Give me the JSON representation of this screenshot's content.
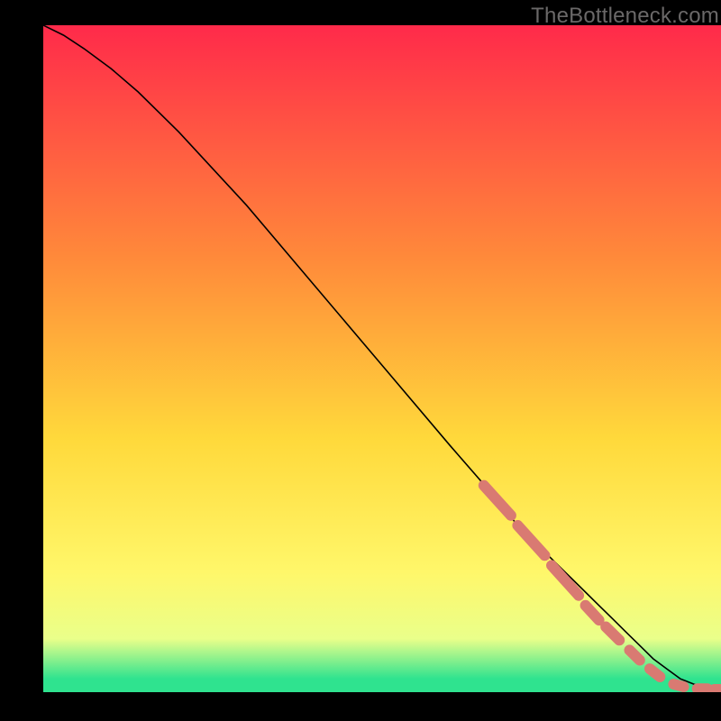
{
  "watermark": {
    "text": "TheBottleneck.com"
  },
  "colors": {
    "top": "#ff2a4a",
    "mid1": "#ff8a3a",
    "mid2": "#ffd93b",
    "mid3": "#fff76a",
    "mid4": "#eaff8a",
    "green": "#2fe38f",
    "marker": "#d97a72",
    "line": "#000000"
  },
  "chart_data": {
    "type": "line",
    "title": "",
    "xlabel": "",
    "ylabel": "",
    "xlim": [
      0,
      100
    ],
    "ylim": [
      0,
      100
    ],
    "grid": false,
    "series": [
      {
        "name": "curve",
        "x": [
          0,
          3,
          6,
          10,
          14,
          20,
          30,
          40,
          50,
          60,
          66,
          68,
          70,
          72,
          74,
          76,
          78,
          80,
          82,
          84,
          86,
          88,
          90,
          92,
          94,
          96,
          98,
          100
        ],
        "values": [
          100,
          98.5,
          96.5,
          93.5,
          90,
          84,
          73,
          61,
          49,
          37,
          30,
          27.5,
          25,
          23,
          21,
          19,
          17,
          15,
          13,
          11,
          9,
          7,
          5,
          3.5,
          2,
          1.2,
          0.6,
          0.4
        ]
      }
    ],
    "marker_segments": [
      {
        "x0": 65,
        "y0": 31,
        "x1": 69,
        "y1": 26.5
      },
      {
        "x0": 70,
        "y0": 25,
        "x1": 74,
        "y1": 20.5
      },
      {
        "x0": 75,
        "y0": 19,
        "x1": 79,
        "y1": 14.5
      },
      {
        "x0": 80,
        "y0": 13,
        "x1": 82,
        "y1": 10.8
      },
      {
        "x0": 83,
        "y0": 9.8,
        "x1": 85,
        "y1": 7.8
      },
      {
        "x0": 86.5,
        "y0": 6.3,
        "x1": 88,
        "y1": 4.8
      },
      {
        "x0": 89.5,
        "y0": 3.5,
        "x1": 91,
        "y1": 2.3
      },
      {
        "x0": 93,
        "y0": 1.2,
        "x1": 94.5,
        "y1": 0.8
      },
      {
        "x0": 96.5,
        "y0": 0.5,
        "x1": 98,
        "y1": 0.5
      },
      {
        "x0": 99,
        "y0": 0.4,
        "x1": 100,
        "y1": 0.4
      }
    ]
  }
}
